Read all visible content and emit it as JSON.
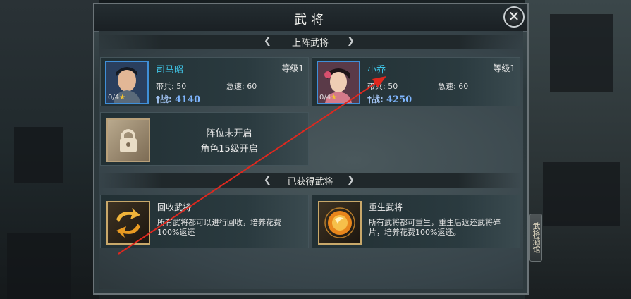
{
  "window": {
    "title": "武将",
    "close_symbol": "✕"
  },
  "sections": {
    "deployed": "上阵武将",
    "acquired": "已获得武将"
  },
  "heroes": [
    {
      "name": "司马昭",
      "level": "等级1",
      "troops_label": "带兵: 50",
      "speed_label": "急速: 60",
      "power_label": "战:",
      "power": "4140",
      "stars": "0/4"
    },
    {
      "name": "小乔",
      "level": "等级1",
      "troops_label": "带兵: 50",
      "speed_label": "急速: 60",
      "power_label": "战:",
      "power": "4250",
      "stars": "0/4"
    }
  ],
  "locked_slot": {
    "line1": "阵位未开启",
    "line2": "角色15级开启"
  },
  "features": {
    "recycle": {
      "title": "回收武将",
      "desc": "所有武将都可以进行回收，培养花费100%返还"
    },
    "rebirth": {
      "title": "重生武将",
      "desc": "所有武将都可重生，重生后返还武将碎片，培养花费100%返还。"
    }
  },
  "side_tab": {
    "label": "武将酒馆"
  },
  "colors": {
    "hero_name": "#3fc4e6",
    "annotation_arrow": "#e0281e"
  },
  "icons": {
    "close": "close-icon",
    "lock": "lock-icon",
    "recycle": "recycle-icon",
    "rebirth": "rebirth-orb-icon"
  }
}
